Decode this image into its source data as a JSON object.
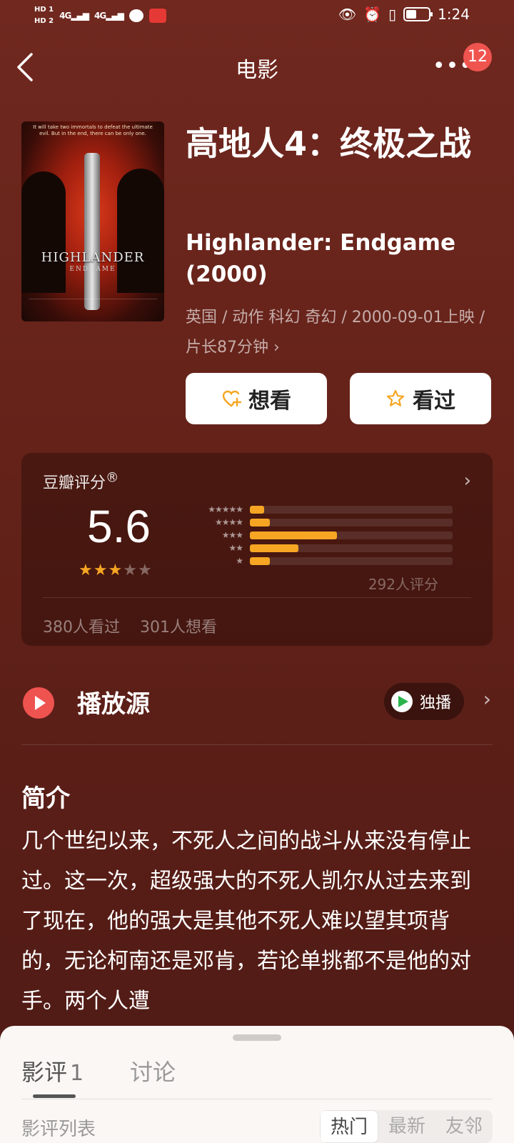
{
  "status_bar": {
    "hd_top": "HD 1",
    "hd_bottom": "HD 2",
    "signal1": "4G",
    "signal2": "4G",
    "time": "1:24"
  },
  "nav": {
    "title": "电影",
    "more_label": "•••",
    "badge_count": "12"
  },
  "movie": {
    "poster_tagline": "It will take two immortals to defeat the ultimate evil. But in the end, there can be only one.",
    "poster_logo": "HIGHLANDER",
    "poster_sublogo": "ENDGAME",
    "title_cn": "高地人4：终极之战",
    "title_en": "Highlander: Endgame (2000)",
    "meta": "英国 / 动作 科幻 奇幻 / 2000-09-01上映 / 片长87分钟 ›"
  },
  "actions": {
    "want_label": "想看",
    "seen_label": "看过",
    "want_icon": "heart-plus-icon",
    "seen_icon": "star-outline-icon"
  },
  "rating": {
    "label": "豆瓣评分",
    "registered": "®",
    "score": "5.6",
    "stars_filled": 3,
    "stars_total": 5,
    "distribution": [
      {
        "stars": "★★★★★",
        "fraction": 0.07
      },
      {
        "stars": "★★★★",
        "fraction": 0.1
      },
      {
        "stars": "★★★",
        "fraction": 0.43
      },
      {
        "stars": "★★",
        "fraction": 0.24
      },
      {
        "stars": "★",
        "fraction": 0.1
      }
    ],
    "count_text": "292人评分",
    "watched_text": "380人看过",
    "wish_text": "301人想看",
    "accent_color": "#f6a623"
  },
  "play_source": {
    "title": "播放源",
    "source_label": "独播",
    "source_icon": "tencent-video-icon"
  },
  "intro": {
    "title": "简介",
    "text": "几个世纪以来，不死人之间的战斗从来没有停止过。这一次，超级强大的不死人凯尔从过去来到了现在，他的强大是其他不死人难以望其项背的，无论柯南还是邓肯，若论单挑都不是他的对手。两个人遭"
  },
  "sheet": {
    "tab_reviews": "影评",
    "tab_reviews_count": "1",
    "tab_discuss": "讨论",
    "list_label": "影评列表",
    "sort_hot": "热门",
    "sort_new": "最新",
    "sort_friends": "友邻"
  }
}
